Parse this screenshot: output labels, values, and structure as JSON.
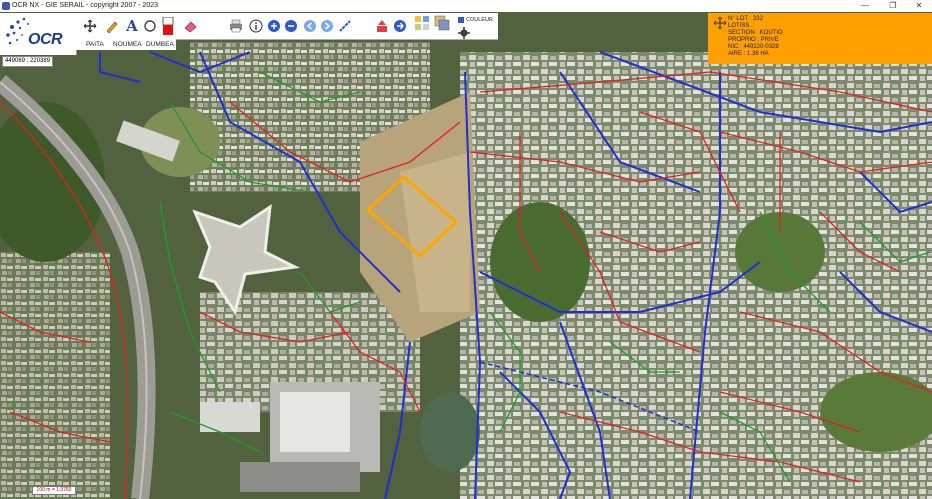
{
  "window": {
    "title": "OCR NX - GIE SERAIL - copyright 2007 - 2023",
    "minimize_glyph": "—",
    "maximize_glyph": "❐",
    "close_glyph": "✕"
  },
  "logo": {
    "text": "OCR"
  },
  "coords": {
    "text": "449069 ; 220389"
  },
  "city_tabs": [
    "PAITA",
    "NOUMEA",
    "DUMBEA"
  ],
  "toolbar": {
    "couleur_label": "COULEUR",
    "tools": [
      "pan-icon",
      "pencil-icon",
      "text-a-icon",
      "circle-icon",
      "color-swatch-icon",
      "eraser-icon",
      "print-icon",
      "info-icon",
      "zoom-in-icon",
      "zoom-out-icon",
      "zoom-prev-icon",
      "zoom-next-icon",
      "measure-icon",
      "export-icon",
      "forward-icon",
      "layers-icon",
      "layer-overlay-icon",
      "settings-icon"
    ]
  },
  "info_panel": {
    "lot": "N° LOT : 332",
    "lotiss": "LOTISS. :",
    "section": "SECTION : KOUTIO",
    "proprio": "PROPRIO : PRIVE",
    "nic": "NIC : 449220-0328",
    "aire": "AIRE : 1.36 HA"
  },
  "scale": {
    "text": "100 m = 1:3760"
  },
  "colors": {
    "accent_orange": "#ffa000",
    "lot_highlight": "#ffa500",
    "network_blue": "#1f2fd0",
    "network_red": "#e02020",
    "network_green": "#1e9a2a"
  }
}
